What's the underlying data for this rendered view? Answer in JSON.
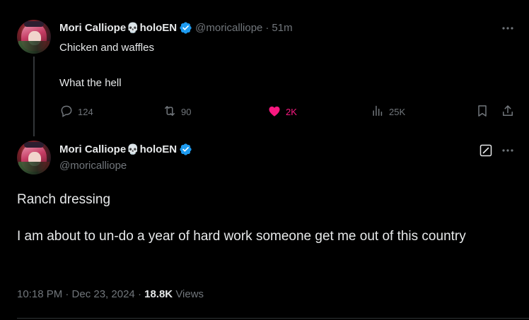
{
  "parent_tweet": {
    "display_name": "Mori Calliope",
    "name_suffix": "holoEN",
    "skull_glyph": "💀",
    "handle": "@moricalliope",
    "separator": "·",
    "time": "51m",
    "lines": [
      "Chicken and waffles",
      "What the hell"
    ],
    "stats": {
      "replies": "124",
      "retweets": "90",
      "likes": "2K",
      "views": "25K"
    },
    "liked": true,
    "icons": [
      "reply-icon",
      "retweet-icon",
      "heart-icon",
      "views-icon",
      "bookmark-icon",
      "share-icon",
      "more-icon"
    ]
  },
  "focused_tweet": {
    "display_name": "Mori Calliope",
    "name_suffix": "holoEN",
    "skull_glyph": "💀",
    "handle": "@moricalliope",
    "lines": [
      "Ranch dressing",
      "I am about to un-do a year of hard work someone get me out of this country"
    ],
    "timestamp": "10:18 PM · Dec 23, 2024",
    "separator": "·",
    "views_count": "18.8K",
    "views_label": "Views",
    "icons": [
      "edit-icon",
      "more-icon"
    ]
  },
  "colors": {
    "background": "#000000",
    "text_primary": "#e7e9ea",
    "text_secondary": "#71767b",
    "like_pink": "#f91880",
    "verified_blue": "#1d9bf0",
    "divider": "#2f3336"
  }
}
